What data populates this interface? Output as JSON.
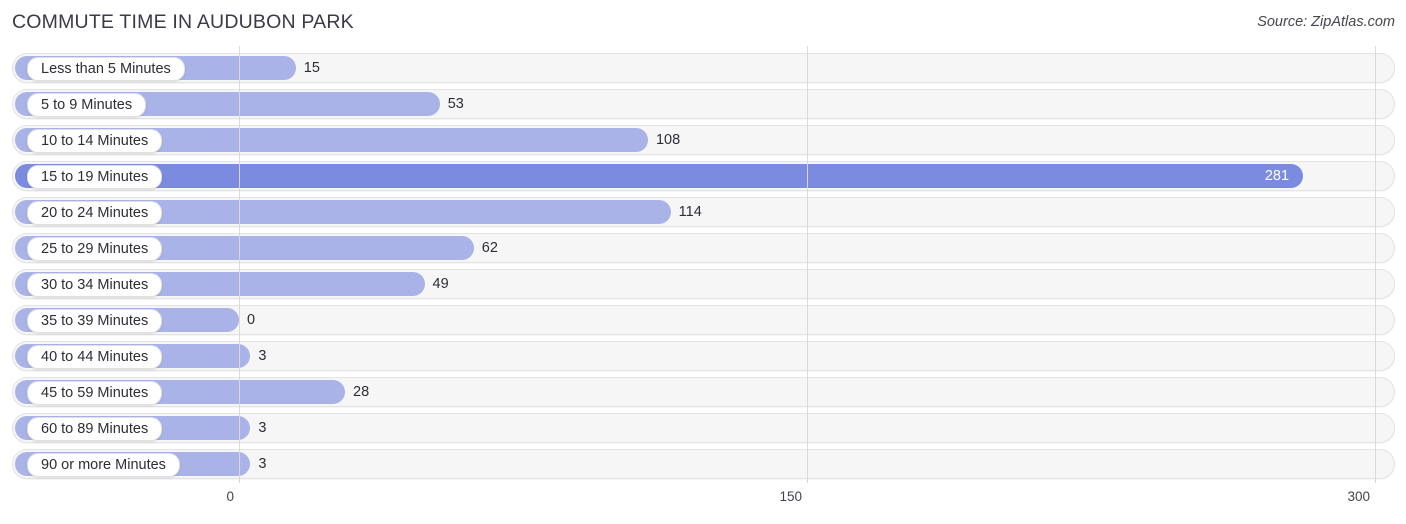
{
  "header": {
    "title": "COMMUTE TIME IN AUDUBON PARK",
    "source": "Source: ZipAtlas.com"
  },
  "chart_data": {
    "type": "bar",
    "orientation": "horizontal",
    "title": "COMMUTE TIME IN AUDUBON PARK",
    "source": "Source: ZipAtlas.com",
    "xlabel": "",
    "ylabel": "",
    "xlim": [
      0,
      300
    ],
    "xticks": [
      0,
      150,
      300
    ],
    "xtick_labels": [
      "0",
      "150",
      "300"
    ],
    "grid": true,
    "legend": false,
    "categories": [
      "Less than 5 Minutes",
      "5 to 9 Minutes",
      "10 to 14 Minutes",
      "15 to 19 Minutes",
      "20 to 24 Minutes",
      "25 to 29 Minutes",
      "30 to 34 Minutes",
      "35 to 39 Minutes",
      "40 to 44 Minutes",
      "45 to 59 Minutes",
      "60 to 89 Minutes",
      "90 or more Minutes"
    ],
    "values": [
      15,
      53,
      108,
      281,
      114,
      62,
      49,
      0,
      3,
      28,
      3,
      3
    ],
    "value_labels": [
      "15",
      "53",
      "108",
      "281",
      "114",
      "62",
      "49",
      "0",
      "3",
      "28",
      "3",
      "3"
    ],
    "max_value": 281,
    "max_category": "15 to 19 Minutes",
    "colors": {
      "bar": "#a9b3e7",
      "bar_highlight": "#7b8ce0",
      "track": "#f6f6f7",
      "track_border": "#e3e3e6",
      "gridline": "#d9d9dd",
      "label_pill": "#ffffff",
      "text": "#2d2d35",
      "title_text": "#3b3b47"
    }
  }
}
